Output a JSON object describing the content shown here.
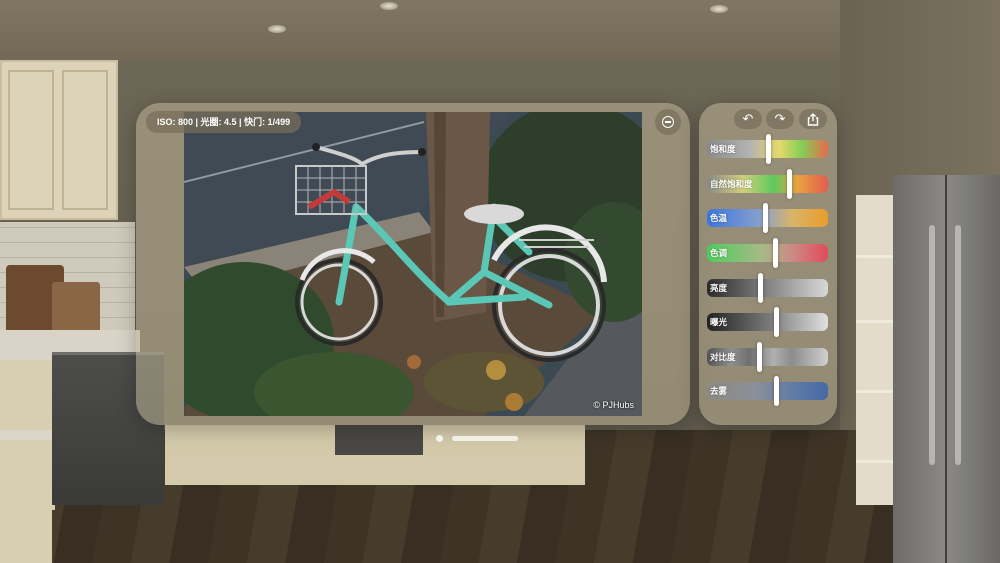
{
  "photo_info": {
    "exif": "ISO: 800 | 光圈: 4.5 | 快门: 1/499",
    "watermark": "© PJHubs"
  },
  "toolbar": {
    "undo_icon": "undo-arrow-icon",
    "redo_icon": "redo-arrow-icon",
    "share_icon": "share-icon",
    "zoom_out_icon": "minus-circle-icon"
  },
  "adjustments": [
    {
      "label": "饱和度",
      "value": 0.5
    },
    {
      "label": "自然饱和度",
      "value": 0.68
    },
    {
      "label": "色温",
      "value": 0.48
    },
    {
      "label": "色调",
      "value": 0.56
    },
    {
      "label": "亮度",
      "value": 0.44
    },
    {
      "label": "曝光",
      "value": 0.57
    },
    {
      "label": "对比度",
      "value": 0.43
    },
    {
      "label": "去雾",
      "value": 0.57
    }
  ]
}
